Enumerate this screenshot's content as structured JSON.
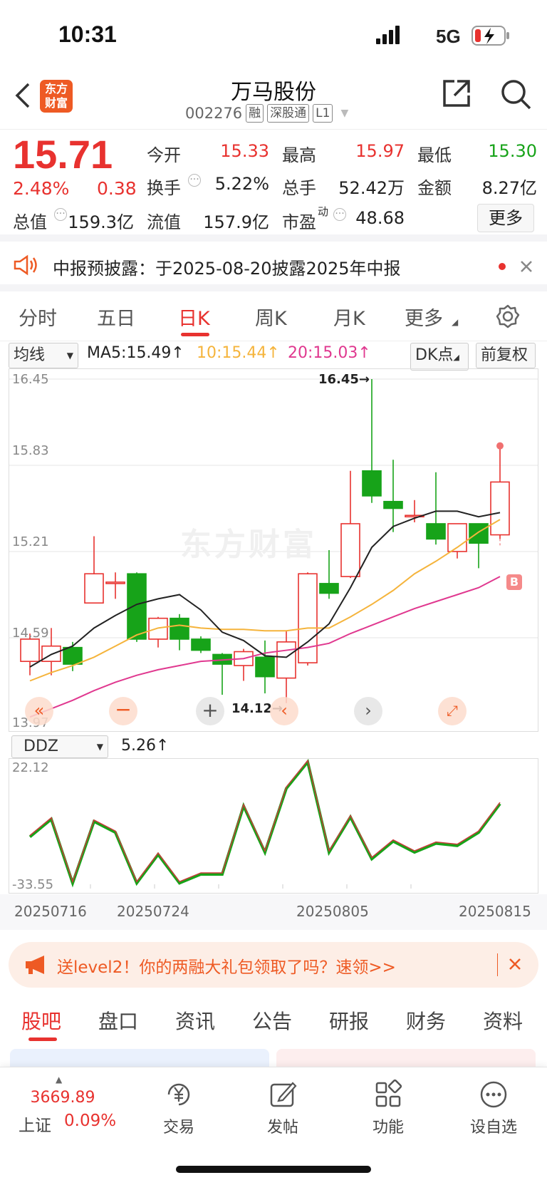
{
  "status_bar": {
    "time": "10:31",
    "network": "5G"
  },
  "header": {
    "title": "万马股份",
    "code": "002276",
    "tags": [
      "融",
      "深股通",
      "L1"
    ],
    "logo_text": "东方财富"
  },
  "quote": {
    "price": "15.71",
    "change_pct": "2.48%",
    "change": "0.38",
    "total_value_label": "总值",
    "total_value": "159.3亿",
    "fields": [
      {
        "label": "今开",
        "value": "15.33"
      },
      {
        "label": "最高",
        "value": "15.97"
      },
      {
        "label": "最低",
        "value": "15.30"
      },
      {
        "label": "换手",
        "value": "5.22%"
      },
      {
        "label": "总手",
        "value": "52.42万"
      },
      {
        "label": "金额",
        "value": "8.27亿"
      },
      {
        "label": "流值",
        "value": "157.9亿"
      },
      {
        "label": "市盈",
        "value": "48.68"
      }
    ],
    "pe_sup": "动",
    "more_label": "更多"
  },
  "notice": {
    "text": "中报预披露：于2025-08-20披露2025年中报"
  },
  "chart_tabs": [
    "分时",
    "五日",
    "日K",
    "周K",
    "月K",
    "更多"
  ],
  "ma_bar": {
    "selector": "均线",
    "ma5": "MA5:15.49",
    "ma10": "10:15.44",
    "ma20": "20:15.03",
    "dk": "DK点",
    "adjust": "前复权"
  },
  "colors": {
    "up": "#e8322f",
    "down": "#17a319",
    "ma5": "#222222",
    "ma10": "#f5b43c",
    "ma20": "#e0388f"
  },
  "price_axis": [
    "16.45",
    "15.83",
    "15.21",
    "14.59",
    "13.97"
  ],
  "annotations": {
    "high": "16.45→",
    "low": "14.12→",
    "b_marker": "B",
    "watermark": "东方财富"
  },
  "chart_data": {
    "type": "candlestick",
    "ylim": [
      13.97,
      16.45
    ],
    "candles": [
      {
        "o": 14.42,
        "c": 14.58,
        "h": 14.62,
        "l": 14.32
      },
      {
        "o": 14.42,
        "c": 14.53,
        "h": 14.66,
        "l": 14.32
      },
      {
        "o": 14.52,
        "c": 14.4,
        "h": 14.56,
        "l": 14.35
      },
      {
        "o": 14.84,
        "c": 15.05,
        "h": 15.32,
        "l": 14.84
      },
      {
        "o": 14.99,
        "c": 14.99,
        "h": 15.06,
        "l": 14.87
      },
      {
        "o": 15.05,
        "c": 14.58,
        "h": 15.06,
        "l": 14.56
      },
      {
        "o": 14.58,
        "c": 14.73,
        "h": 14.74,
        "l": 14.52
      },
      {
        "o": 14.73,
        "c": 14.58,
        "h": 14.76,
        "l": 14.5
      },
      {
        "o": 14.58,
        "c": 14.5,
        "h": 14.6,
        "l": 14.48
      },
      {
        "o": 14.47,
        "c": 14.4,
        "h": 14.48,
        "l": 14.18
      },
      {
        "o": 14.39,
        "c": 14.49,
        "h": 14.51,
        "l": 14.28
      },
      {
        "o": 14.45,
        "c": 14.31,
        "h": 14.57,
        "l": 14.19
      },
      {
        "o": 14.3,
        "c": 14.56,
        "h": 14.64,
        "l": 14.12
      },
      {
        "o": 14.41,
        "c": 15.05,
        "h": 15.06,
        "l": 14.39
      },
      {
        "o": 14.98,
        "c": 14.91,
        "h": 15.22,
        "l": 14.87
      },
      {
        "o": 15.03,
        "c": 15.41,
        "h": 15.79,
        "l": 15.02
      },
      {
        "o": 15.79,
        "c": 15.61,
        "h": 16.45,
        "l": 15.56
      },
      {
        "o": 15.57,
        "c": 15.52,
        "h": 15.87,
        "l": 15.35
      },
      {
        "o": 15.47,
        "c": 15.47,
        "h": 15.58,
        "l": 15.42
      },
      {
        "o": 15.41,
        "c": 15.3,
        "h": 15.78,
        "l": 15.26
      },
      {
        "o": 15.21,
        "c": 15.41,
        "h": 15.41,
        "l": 15.16
      },
      {
        "o": 15.41,
        "c": 15.27,
        "h": 15.41,
        "l": 15.09
      },
      {
        "o": 15.33,
        "c": 15.71,
        "h": 15.97,
        "l": 15.3
      }
    ],
    "ma5": [
      14.38,
      14.47,
      14.53,
      14.66,
      14.75,
      14.83,
      14.87,
      14.9,
      14.79,
      14.63,
      14.57,
      14.46,
      14.45,
      14.56,
      14.69,
      14.95,
      15.24,
      15.39,
      15.45,
      15.5,
      15.5,
      15.46,
      15.49
    ],
    "ma10": [
      14.28,
      14.34,
      14.39,
      14.45,
      14.53,
      14.61,
      14.66,
      14.68,
      14.66,
      14.65,
      14.65,
      14.64,
      14.64,
      14.66,
      14.66,
      14.74,
      14.83,
      14.93,
      15.05,
      15.14,
      15.24,
      15.35,
      15.44
    ],
    "ma20": [
      14.02,
      14.08,
      14.14,
      14.21,
      14.27,
      14.32,
      14.36,
      14.39,
      14.42,
      14.43,
      14.44,
      14.48,
      14.5,
      14.52,
      14.55,
      14.62,
      14.68,
      14.74,
      14.8,
      14.85,
      14.9,
      14.95,
      15.03
    ]
  },
  "ddz": {
    "selector": "DDZ",
    "value": "5.26",
    "axis_top": "22.12",
    "axis_bottom": "-33.55",
    "ylim": [
      -33.55,
      22.12
    ],
    "series": [
      -12,
      -4,
      -33,
      -5,
      -10,
      -33,
      -20,
      -33,
      -29,
      -29,
      2,
      -19,
      10,
      22,
      -19,
      -3,
      -22,
      -14,
      -19,
      -15,
      -16,
      -10,
      3
    ],
    "dates": [
      "20250716",
      "20250724",
      "20250805",
      "20250815"
    ]
  },
  "ad": {
    "text": "送level2！你的两融大礼包领取了吗？速领>>"
  },
  "sub_tabs": [
    "股吧",
    "盘口",
    "资讯",
    "公告",
    "研报",
    "财务",
    "资料"
  ],
  "bottom_nav": {
    "index_value": "3669.89",
    "index_name": "上证",
    "index_pct": "0.09%",
    "items": [
      "交易",
      "发帖",
      "功能",
      "设自选"
    ]
  }
}
